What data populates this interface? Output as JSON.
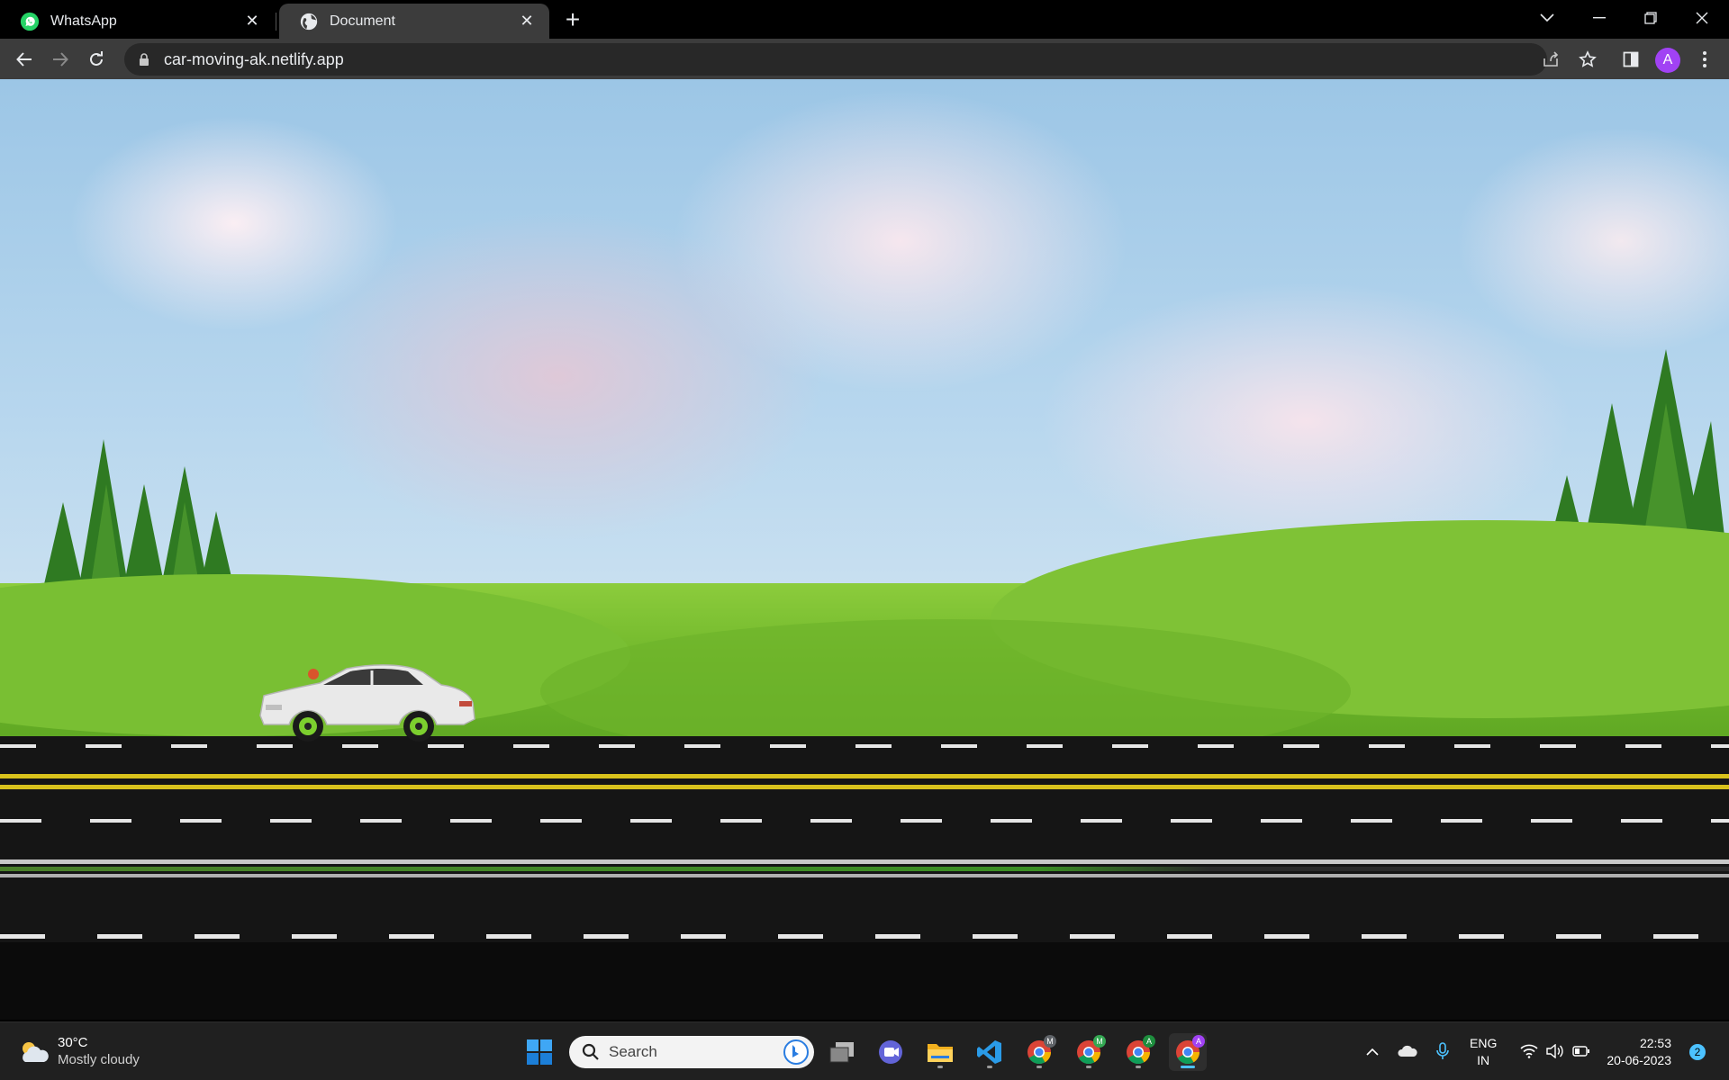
{
  "browser": {
    "tabs": [
      {
        "title": "WhatsApp",
        "favicon": "whatsapp-icon",
        "active": false
      },
      {
        "title": "Document",
        "favicon": "globe-icon",
        "active": true
      }
    ],
    "url": "car-moving-ak.netlify.app",
    "profile_initial": "A"
  },
  "page": {
    "scene": "animated car on road with grassy hills and cloudy sky",
    "colors": {
      "grass": "#6fb62a",
      "road": "#151515",
      "yellow_line": "#d9c21c",
      "white_dash": "#e6e6e6",
      "sky": "#9cc6e6"
    }
  },
  "taskbar": {
    "weather": {
      "temperature": "30°C",
      "condition": "Mostly cloudy"
    },
    "search_placeholder": "Search",
    "language": {
      "line1": "ENG",
      "line2": "IN"
    },
    "clock": {
      "time": "22:53",
      "date": "20-06-2023"
    },
    "notification_count": "2",
    "chrome_badges": [
      "M",
      "M",
      "A",
      "A"
    ]
  }
}
